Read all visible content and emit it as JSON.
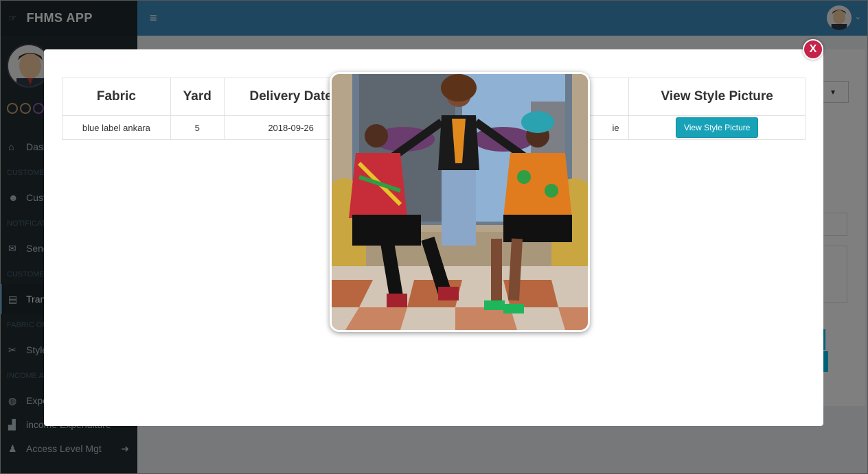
{
  "app": {
    "brand": "FHMS APP"
  },
  "sidebar": {
    "items": [
      {
        "type": "item",
        "label": "Dashboard",
        "icon": "home-icon"
      },
      {
        "type": "header",
        "label": "CUSTOMER"
      },
      {
        "type": "item",
        "label": "Customers",
        "icon": "users-icon"
      },
      {
        "type": "header",
        "label": "NOTIFICATION"
      },
      {
        "type": "item",
        "label": "Send",
        "icon": "envelope-icon"
      },
      {
        "type": "header",
        "label": "CUSTOMER"
      },
      {
        "type": "item",
        "label": "Transactions",
        "icon": "clipboard-icon",
        "active": true
      },
      {
        "type": "header",
        "label": "FABRIC ORDER"
      },
      {
        "type": "item",
        "label": "Style",
        "icon": "scissors-icon"
      },
      {
        "type": "header",
        "label": "INCOME AND EXPENDITURE"
      },
      {
        "type": "item",
        "label": "Expenditure",
        "icon": "money-icon"
      },
      {
        "type": "item",
        "label": "income Expenditure",
        "icon": "chart-icon"
      },
      {
        "type": "item",
        "label": "Access Level Mgt",
        "icon": "user-icon",
        "arrow": true
      }
    ]
  },
  "modal": {
    "close_label": "X",
    "table": {
      "headers": [
        "Fabric",
        "Yard",
        "Delivery Date",
        "",
        "View Style Picture"
      ],
      "rows": [
        {
          "fabric": "blue label ankara",
          "yard": "5",
          "delivery_date": "2018-09-26",
          "extra": "ie",
          "button": "View Style Picture"
        }
      ]
    }
  },
  "photo": {
    "subject": "three women posing in colorful ankara print outfits"
  },
  "colors": {
    "sidebar": "#222d32",
    "topbar": "#3c8dbc",
    "close": "#c4234a",
    "view_button": "#17a2b8"
  }
}
